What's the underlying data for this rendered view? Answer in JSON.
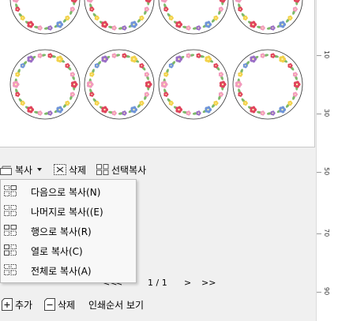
{
  "toolbar": {
    "copy_label": "복사",
    "delete_label": "삭제",
    "select_copy_label": "선택복사"
  },
  "copy_menu": {
    "items": [
      {
        "label": "다음으로 복사(N)"
      },
      {
        "label": "나머지로 복사((E)"
      },
      {
        "label": "행으로 복사(R)"
      },
      {
        "label": "열로 복사(C)"
      },
      {
        "label": "전체로 복사(A)"
      }
    ]
  },
  "pager": {
    "first": "<<",
    "prev": "<",
    "page": "1 / 1",
    "next": ">",
    "last": ">>"
  },
  "bottom_bar": {
    "add_label": "추가",
    "delete_label": "삭제",
    "print_order_label": "인쇄순서 보기"
  },
  "ruler": {
    "ticks": [
      "10",
      "30",
      "50",
      "70",
      "90"
    ]
  },
  "colors": {
    "flower_red": "#e0445c",
    "flower_pink": "#f29bbd",
    "flower_yellow": "#f2d24b",
    "flower_blue": "#6f95d8",
    "flower_purple": "#9b6fc6",
    "leaf_green": "#7db86a"
  }
}
